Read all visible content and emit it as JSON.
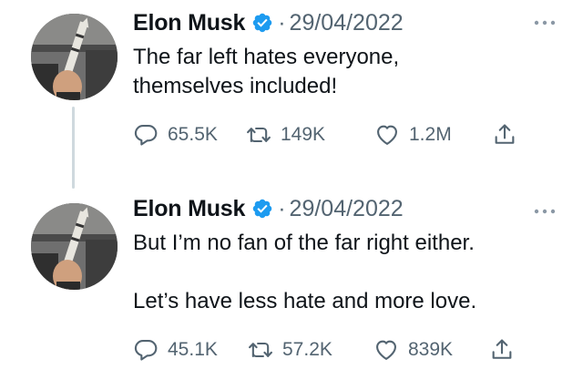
{
  "tweets": [
    {
      "author": "Elon Musk",
      "separator": "·",
      "date": "29/04/2022",
      "text": "The far left hates everyone,\nthemselves included!",
      "replies": "65.5K",
      "retweets": "149K",
      "likes": "1.2M"
    },
    {
      "author": "Elon Musk",
      "separator": "·",
      "date": "29/04/2022",
      "text": "But I’m no fan of the far right either.\n\nLet’s have less hate and more love.",
      "replies": "45.1K",
      "retweets": "57.2K",
      "likes": "839K"
    }
  ],
  "icons": {
    "verified": "verified-badge-icon",
    "more": "more-dots-icon",
    "reply": "reply-icon",
    "retweet": "retweet-icon",
    "like": "heart-icon",
    "share": "share-icon"
  },
  "colors": {
    "verified": "#1d9bf0",
    "muted": "#536471",
    "text": "#0f1419",
    "thread_line": "#cfd9de"
  }
}
